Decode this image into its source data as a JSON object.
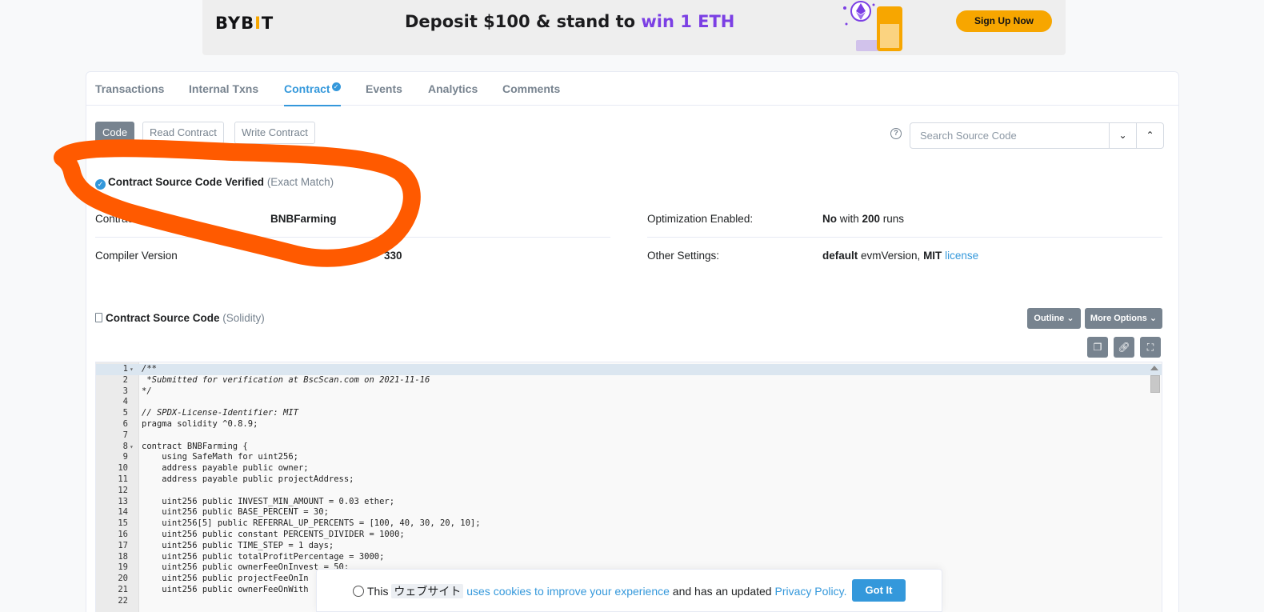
{
  "banner": {
    "logo_prefix": "BYB",
    "logo_bar": "I",
    "logo_suffix": "T",
    "headline_prefix": "Deposit $100 & stand to ",
    "headline_accent": "win 1 ETH",
    "cta_label": "Sign Up Now"
  },
  "tabs": [
    {
      "label": "Transactions"
    },
    {
      "label": "Internal Txns"
    },
    {
      "label": "Contract"
    },
    {
      "label": "Events"
    },
    {
      "label": "Analytics"
    },
    {
      "label": "Comments"
    }
  ],
  "subtabs": [
    {
      "label": "Code"
    },
    {
      "label": "Read Contract"
    },
    {
      "label": "Write Contract"
    }
  ],
  "search": {
    "placeholder": "Search Source Code"
  },
  "verification": {
    "title": "Contract Source Code Verified",
    "match": "(Exact Match)"
  },
  "details": {
    "contract_name_label": "Contract Name:",
    "contract_name_value": "BNBFarming",
    "compiler_label": "Compiler Version",
    "compiler_value": "330",
    "optimization_label": "Optimization Enabled:",
    "optimization_value": "No",
    "optimization_with": " with ",
    "optimization_runs": "200",
    "optimization_runs_suffix": " runs",
    "other_label": "Other Settings:",
    "other_default": "default",
    "other_evm": " evmVersion, ",
    "other_license": "MIT",
    "other_license_link": "license"
  },
  "source": {
    "title": "Contract Source Code",
    "lang": "(Solidity)",
    "outline_label": "Outline",
    "more_label": "More Options"
  },
  "code_lines": [
    {
      "n": "1",
      "fold": true,
      "t": "/**",
      "cls": "c-cmt"
    },
    {
      "n": "2",
      "fold": false,
      "t": " *Submitted for verification at BscScan.com on 2021-11-16",
      "cls": "c-cmt"
    },
    {
      "n": "3",
      "fold": false,
      "t": "*/",
      "cls": "c-cmt"
    },
    {
      "n": "4",
      "fold": false,
      "t": "",
      "cls": ""
    },
    {
      "n": "5",
      "fold": false,
      "t": "// SPDX-License-Identifier: MIT",
      "cls": "c-cmt"
    },
    {
      "n": "6",
      "fold": false,
      "t": "pragma solidity ^0.8.9;",
      "cls": ""
    },
    {
      "n": "7",
      "fold": false,
      "t": "",
      "cls": ""
    },
    {
      "n": "8",
      "fold": true,
      "t": "contract BNBFarming {",
      "cls": ""
    },
    {
      "n": "9",
      "fold": false,
      "t": "    using SafeMath for uint256;",
      "cls": ""
    },
    {
      "n": "10",
      "fold": false,
      "t": "    address payable public owner;",
      "cls": ""
    },
    {
      "n": "11",
      "fold": false,
      "t": "    address payable public projectAddress;",
      "cls": ""
    },
    {
      "n": "12",
      "fold": false,
      "t": "",
      "cls": ""
    },
    {
      "n": "13",
      "fold": false,
      "t": "    uint256 public INVEST_MIN_AMOUNT = 0.03 ether;",
      "cls": ""
    },
    {
      "n": "14",
      "fold": false,
      "t": "    uint256 public BASE_PERCENT = 30;",
      "cls": ""
    },
    {
      "n": "15",
      "fold": false,
      "t": "    uint256[5] public REFERRAL_UP_PERCENTS = [100, 40, 30, 20, 10];",
      "cls": ""
    },
    {
      "n": "16",
      "fold": false,
      "t": "    uint256 public constant PERCENTS_DIVIDER = 1000;",
      "cls": ""
    },
    {
      "n": "17",
      "fold": false,
      "t": "    uint256 public TIME_STEP = 1 days;",
      "cls": ""
    },
    {
      "n": "18",
      "fold": false,
      "t": "    uint256 public totalProfitPercentage = 3000;",
      "cls": ""
    },
    {
      "n": "19",
      "fold": false,
      "t": "    uint256 public ownerFeeOnInvest = 50;",
      "cls": ""
    },
    {
      "n": "20",
      "fold": false,
      "t": "    uint256 public projectFeeOnIn",
      "cls": ""
    },
    {
      "n": "21",
      "fold": false,
      "t": "    uint256 public ownerFeeOnWith",
      "cls": ""
    },
    {
      "n": "22",
      "fold": false,
      "t": "",
      "cls": ""
    }
  ],
  "cookie": {
    "prefix": "This ",
    "jp": "ウェブサイト",
    "link1": "uses cookies to improve your experience",
    "middle": " and has an updated ",
    "link2": "Privacy Policy.",
    "button": "Got It"
  },
  "colors": {
    "accent": "#3498db",
    "muted": "#77838f",
    "annotation": "#ff5a00",
    "bybit_yellow": "#f7a600"
  }
}
